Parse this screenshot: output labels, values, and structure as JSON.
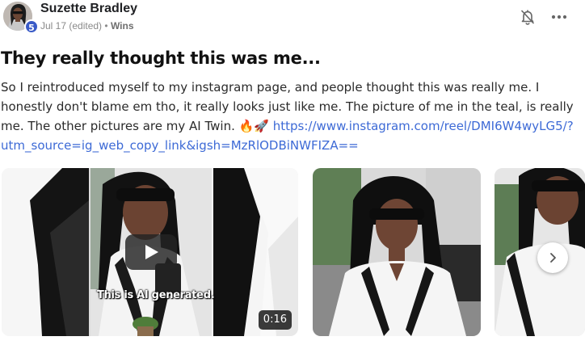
{
  "post": {
    "author": "Suzette Bradley",
    "level": "5",
    "date": "Jul 17 (edited)",
    "separator": "•",
    "category": "Wins",
    "title": "They really thought this was me...",
    "body_text": "So I reintroduced myself to my instagram page, and people thought this was really me. I honestly don't blame em tho, it really looks just like me. The picture of me in the teal, is really me. The other pictures are my AI Twin. 🔥🚀 ",
    "link": "https://www.instagram.com/reel/DMI6W4wyLG5/?utm_source=ig_web_copy_link&igsh=MzRlODBiNWFIZA=="
  },
  "icons": {
    "notify": "bell-off-icon",
    "more": "more-horizontal-icon",
    "play": "play-icon",
    "next": "chevron-right-icon"
  },
  "media": {
    "video_caption": "This is AI generated.",
    "video_duration": "0:16"
  },
  "colors": {
    "link": "#3d6ad6",
    "level_badge": "#3a5bc7",
    "meta_text": "#8a8a8a"
  }
}
